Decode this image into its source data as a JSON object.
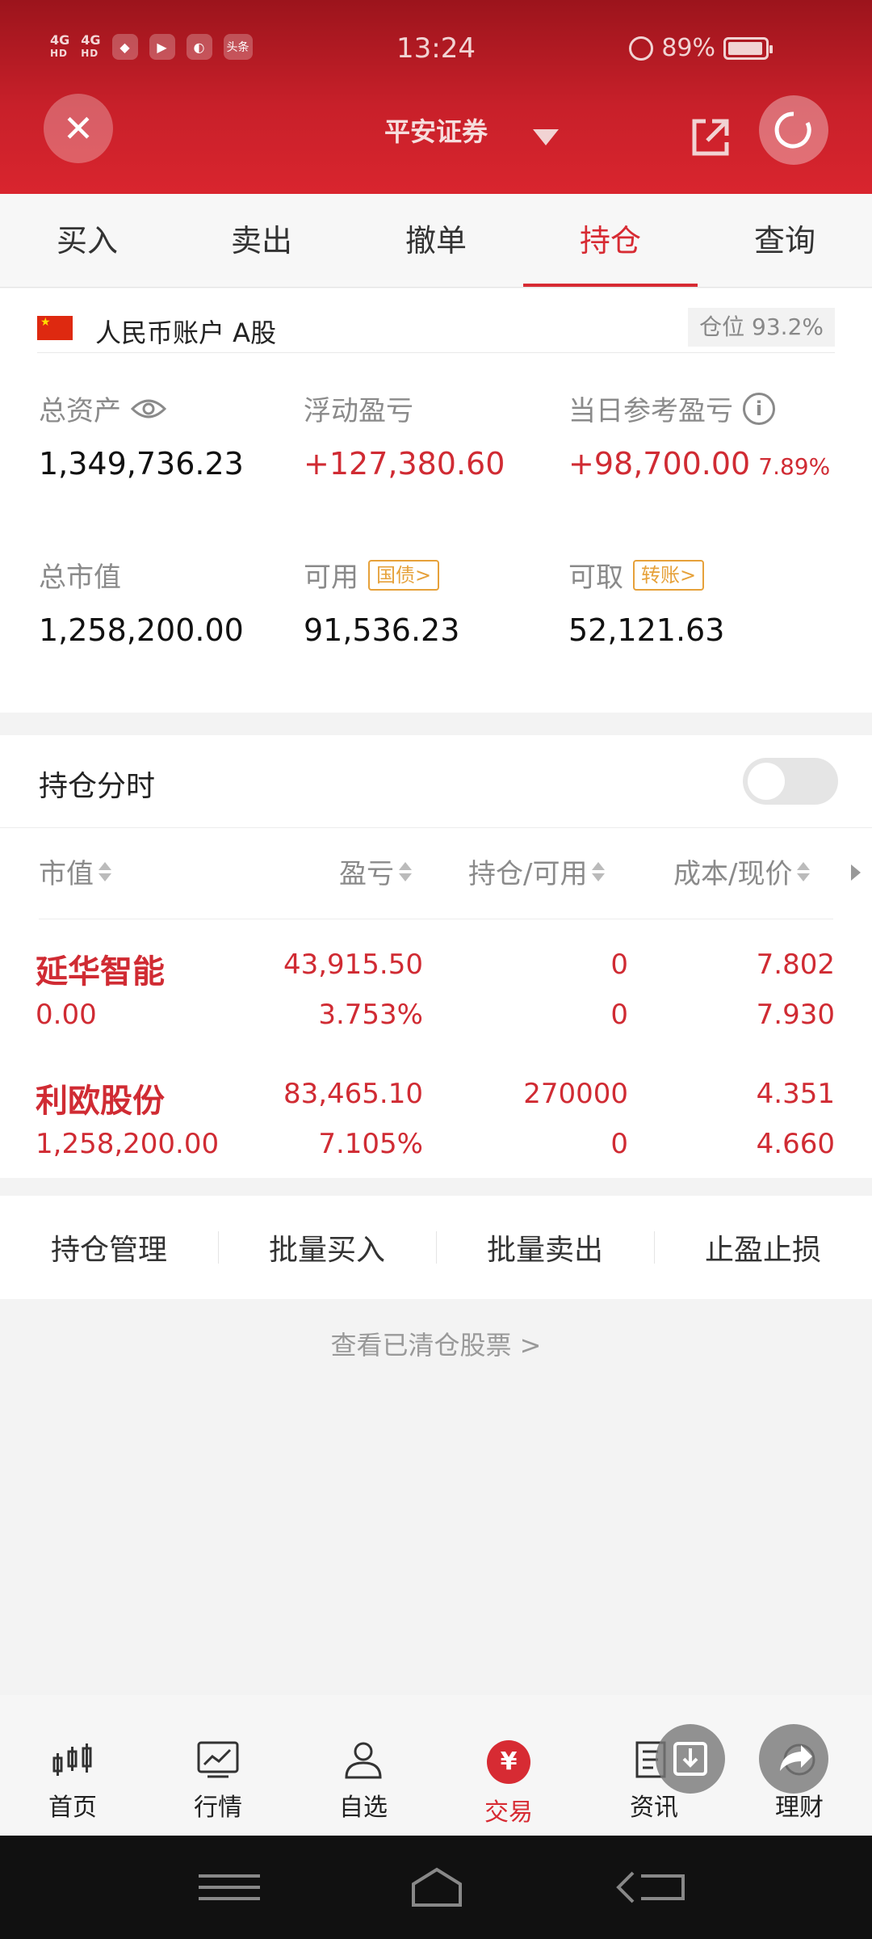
{
  "status_bar": {
    "time": "13:24",
    "battery": "89%",
    "net1": "4G",
    "net1_sub": "HD",
    "net2": "4G",
    "net2_sub": "HD",
    "app_badge": "头条"
  },
  "header": {
    "broker": "平安证券"
  },
  "tabs": [
    {
      "label": "买入"
    },
    {
      "label": "卖出"
    },
    {
      "label": "撤单"
    },
    {
      "label": "持仓"
    },
    {
      "label": "查询"
    }
  ],
  "active_tab": "持仓",
  "account": {
    "label": "人民币账户 A股",
    "position_ratio": "仓位 93.2%",
    "metrics": {
      "total_assets": {
        "label": "总资产",
        "value": "1,349,736.23"
      },
      "floating_pl": {
        "label": "浮动盈亏",
        "value": "+127,380.60"
      },
      "daily_pl": {
        "label": "当日参考盈亏",
        "value": "+98,700.00",
        "pct": "7.89%"
      },
      "market_value": {
        "label": "总市值",
        "value": "1,258,200.00"
      },
      "available": {
        "label": "可用",
        "tag": "国债>",
        "value": "91,536.23"
      },
      "withdrawable": {
        "label": "可取",
        "tag": "转账>",
        "value": "52,121.63"
      }
    }
  },
  "holdings": {
    "title": "持仓分时",
    "columns": [
      "市值",
      "盈亏",
      "持仓/可用",
      "成本/现价"
    ],
    "rows": [
      {
        "name": "延华智能",
        "market_value": "0.00",
        "pl": "43,915.50",
        "pl_pct": "3.753%",
        "position": "0",
        "available": "0",
        "cost": "7.802",
        "price": "7.930"
      },
      {
        "name": "利欧股份",
        "market_value": "1,258,200.00",
        "pl": "83,465.10",
        "pl_pct": "7.105%",
        "position": "270000",
        "available": "0",
        "cost": "4.351",
        "price": "4.660"
      }
    ]
  },
  "actions": [
    "持仓管理",
    "批量买入",
    "批量卖出",
    "止盈止损"
  ],
  "cleared_link": "查看已清仓股票 >",
  "bottom_nav": [
    {
      "label": "首页",
      "icon": "candlestick-icon"
    },
    {
      "label": "行情",
      "icon": "chart-icon"
    },
    {
      "label": "自选",
      "icon": "person-icon"
    },
    {
      "label": "交易",
      "icon": "yen-icon"
    },
    {
      "label": "资讯",
      "icon": "news-icon"
    },
    {
      "label": "理财",
      "icon": "finance-icon"
    }
  ],
  "colors": {
    "brand_red": "#d72b33",
    "header_red": "#c8202a",
    "tag_orange": "#e6a13a"
  }
}
